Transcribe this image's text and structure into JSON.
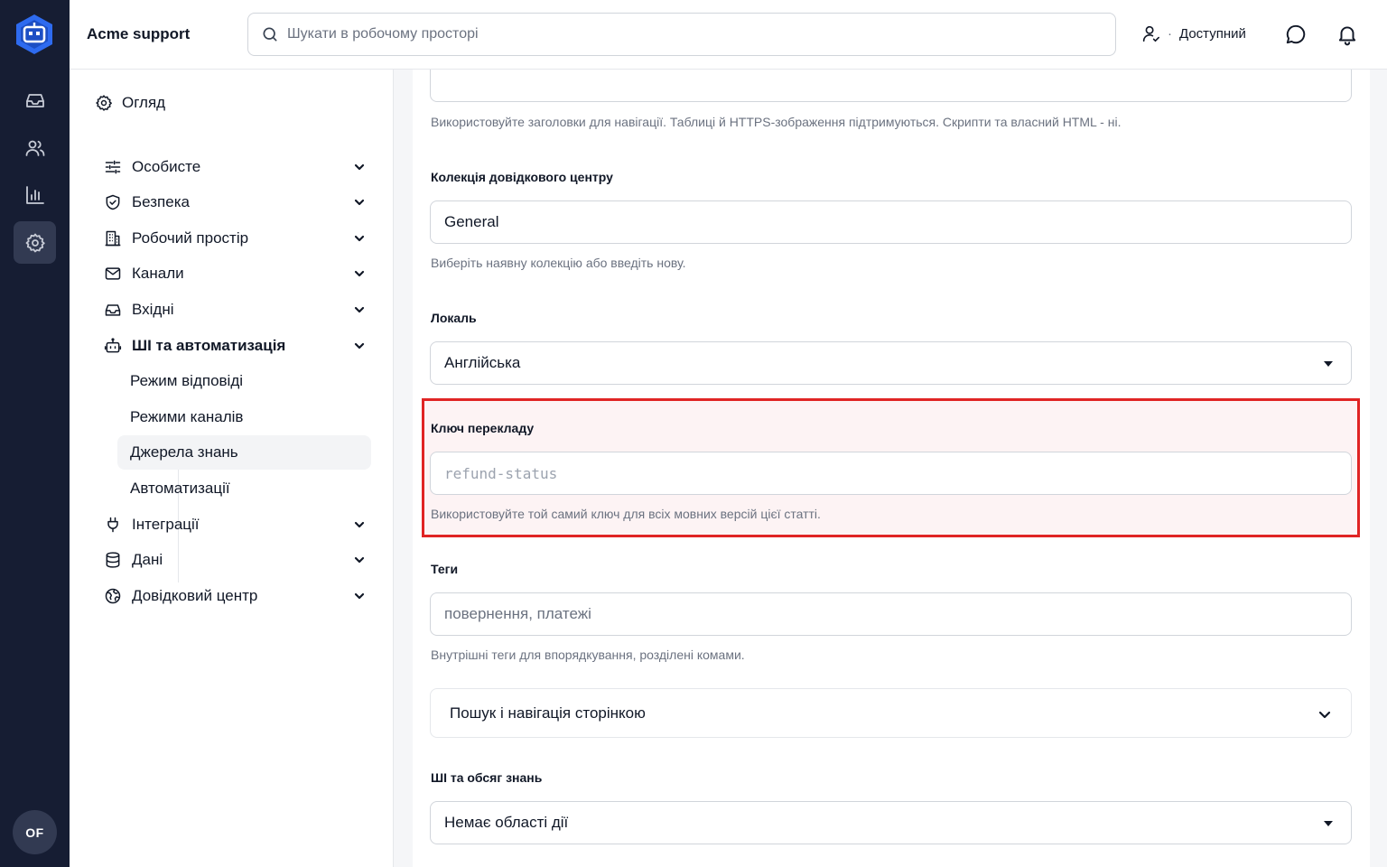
{
  "rail": {
    "avatar_initials": "OF",
    "icons": [
      "logo-icon",
      "inbox-icon",
      "users-icon",
      "reports-icon",
      "settings-icon"
    ],
    "active": "settings-icon",
    "background": "#161d33",
    "accent": "#2e6bf0"
  },
  "topbar": {
    "workspace": "Acme support",
    "search_placeholder": "Шукати в робочому просторі",
    "presence_dot": "·",
    "presence_status": "Доступний"
  },
  "settings_nav": {
    "overview": "Огляд",
    "items": [
      {
        "label": "Особисте",
        "icon": "sliders-icon"
      },
      {
        "label": "Безпека",
        "icon": "shield-icon"
      },
      {
        "label": "Робочий простір",
        "icon": "building-icon"
      },
      {
        "label": "Канали",
        "icon": "mail-icon"
      },
      {
        "label": "Вхідні",
        "icon": "inbox-icon"
      },
      {
        "label": "ШІ та автоматизація",
        "icon": "bot-icon"
      },
      {
        "label": "Інтеграції",
        "icon": "plug-icon"
      },
      {
        "label": "Дані",
        "icon": "database-icon"
      },
      {
        "label": "Довідковий центр",
        "icon": "globe-icon"
      }
    ],
    "expanded_item": "ШІ та автоматизація",
    "sub_items": [
      "Режим відповіді",
      "Режими каналів",
      "Джерела знань",
      "Автоматизації"
    ],
    "active_sub_item": "Джерела знань"
  },
  "form": {
    "content_help": "Використовуйте заголовки для навігації. Таблиці й HTTPS-зображення підтримуються. Скрипти та власний HTML - ні.",
    "collection": {
      "label": "Колекція довідкового центру",
      "value": "General",
      "help": "Виберіть наявну колекцію або введіть нову."
    },
    "locale": {
      "label": "Локаль",
      "value": "Англійська"
    },
    "translation_key": {
      "label": "Ключ перекладу",
      "placeholder": "refund-status",
      "help": "Використовуйте той самий ключ для всіх мовних версій цієї статті.",
      "highlight_color": "#e02424"
    },
    "tags": {
      "label": "Теги",
      "placeholder": "повернення, платежі",
      "help": "Внутрішні теги для впорядкування, розділені комами."
    },
    "accordion_label": "Пошук і навігація сторінкою",
    "ai_scope": {
      "label": "ШІ та обсяг знань",
      "value": "Немає області дії"
    }
  }
}
